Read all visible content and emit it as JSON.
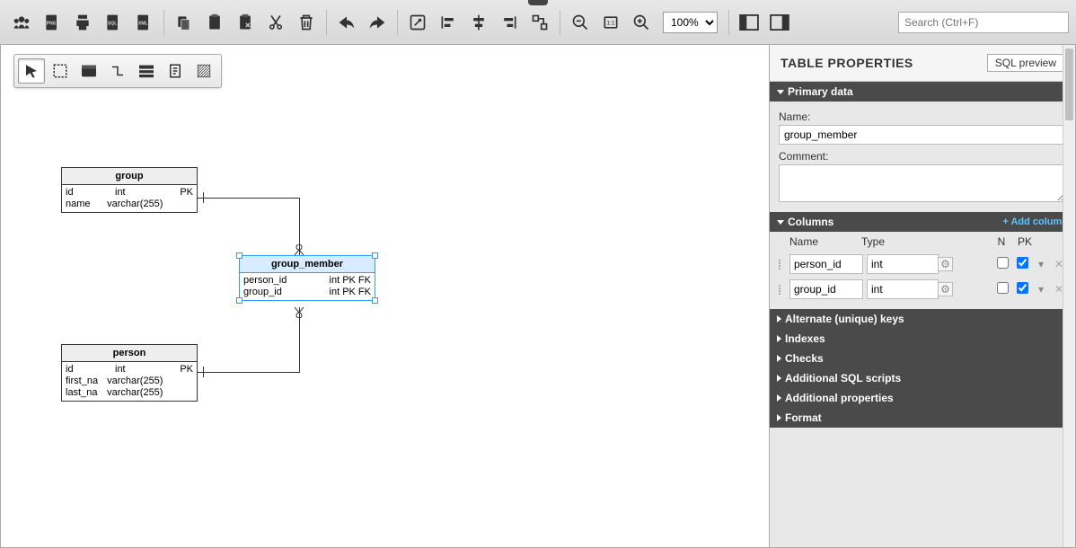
{
  "zoom": "100%",
  "search_placeholder": "Search (Ctrl+F)",
  "canvas": {
    "tables": {
      "group": {
        "title": "group",
        "rows": [
          {
            "name": "id",
            "type": "int",
            "flags": "PK"
          },
          {
            "name": "name",
            "type": "varchar(255)",
            "flags": ""
          }
        ]
      },
      "group_member": {
        "title": "group_member",
        "rows": [
          {
            "name": "person_id",
            "type": "int PK FK",
            "flags": ""
          },
          {
            "name": "group_id",
            "type": "int PK FK",
            "flags": ""
          }
        ]
      },
      "person": {
        "title": "person",
        "rows": [
          {
            "name": "id",
            "type": "int",
            "flags": "PK"
          },
          {
            "name": "first_na",
            "type": "varchar(255)",
            "flags": ""
          },
          {
            "name": "last_na",
            "type": "varchar(255)",
            "flags": ""
          }
        ]
      }
    }
  },
  "panel": {
    "title": "TABLE PROPERTIES",
    "sql_preview": "SQL preview",
    "sections": {
      "primary_data": "Primary data",
      "columns": "Columns",
      "add_column": "+ Add column",
      "alternate_keys": "Alternate (unique) keys",
      "indexes": "Indexes",
      "checks": "Checks",
      "additional_sql": "Additional SQL scripts",
      "additional_props": "Additional properties",
      "format": "Format"
    },
    "primary": {
      "name_label": "Name:",
      "name_value": "group_member",
      "comment_label": "Comment:",
      "comment_value": ""
    },
    "columns": {
      "header": {
        "name": "Name",
        "type": "Type",
        "n": "N",
        "pk": "PK"
      },
      "rows": [
        {
          "name": "person_id",
          "type": "int",
          "n": false,
          "pk": true
        },
        {
          "name": "group_id",
          "type": "int",
          "n": false,
          "pk": true
        }
      ]
    }
  }
}
